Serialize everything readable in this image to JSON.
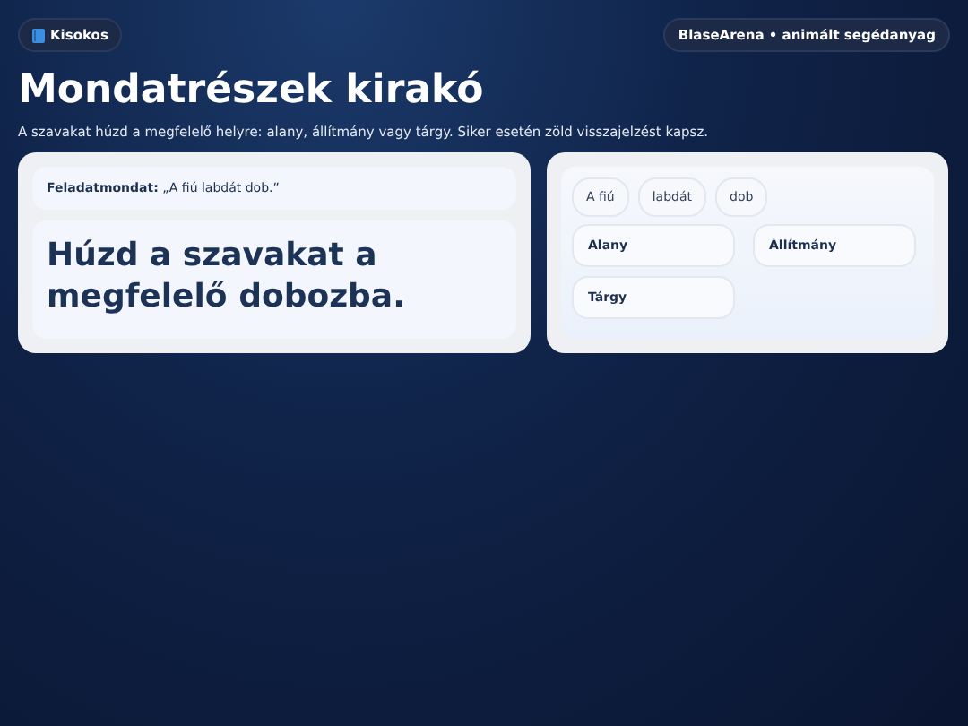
{
  "header": {
    "badge": "Kisokos",
    "brand": "BlaseArena • animált segédanyag"
  },
  "title": "Mondatrészek kirakó",
  "subtitle": "A szavakat húzd a megfelelő helyre: alany, állítmány vagy tárgy. Siker esetén zöld visszajelzést kapsz.",
  "task": {
    "sentence": "**Feladatmondat:** „A fiú labdát dob.”",
    "instruction": "Húzd a szavakat a megfelelő dobozba."
  },
  "words": [
    "A fiú",
    "labdát",
    "dob"
  ],
  "targets": [
    "Alany",
    "Állítmány",
    "Tárgy"
  ]
}
